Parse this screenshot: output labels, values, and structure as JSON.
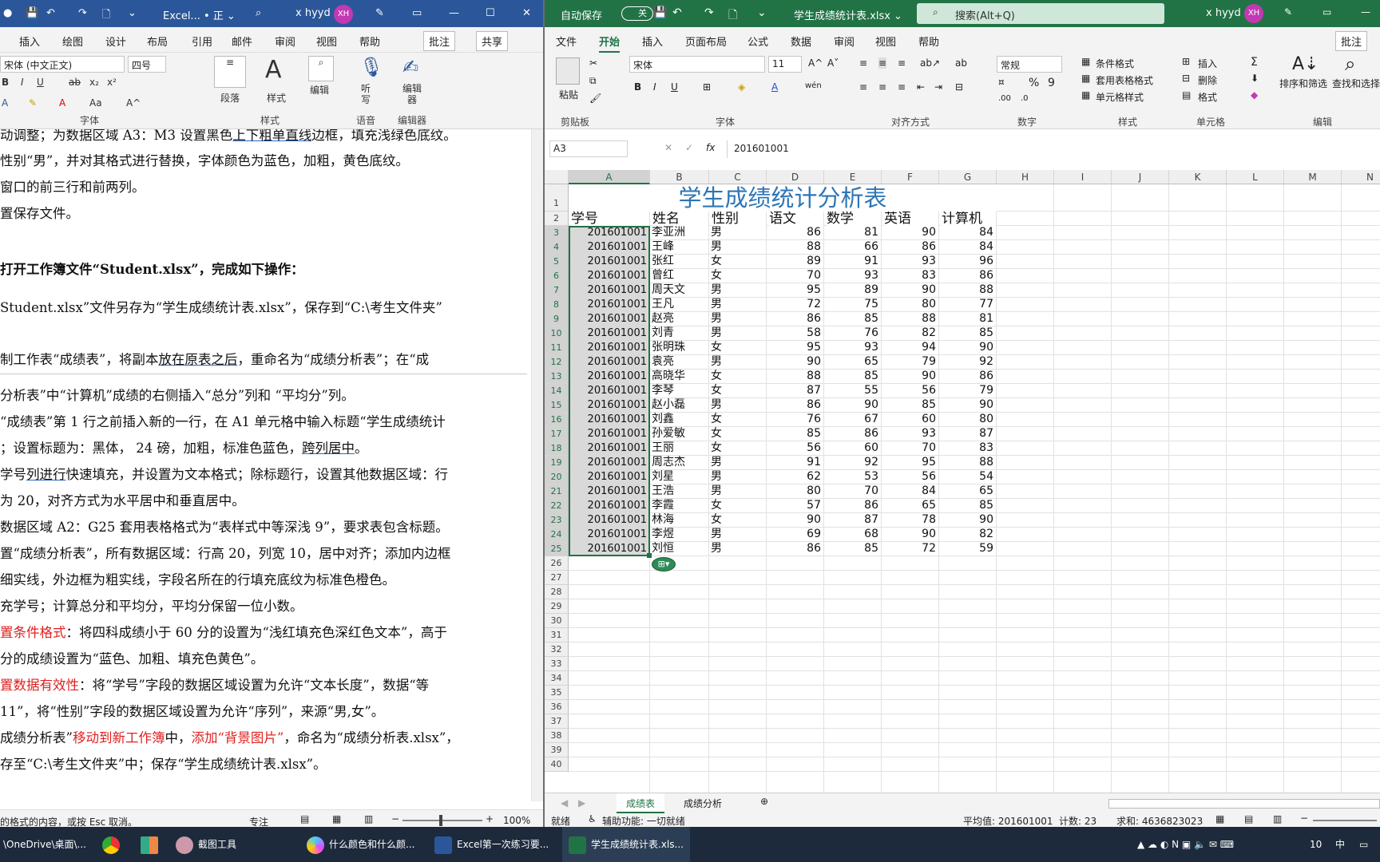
{
  "word": {
    "title": "Excel... • 正 ⌄",
    "search_icon": "search-icon",
    "user": "x hyyd",
    "avatar": "XH",
    "menu": [
      "插入",
      "绘图",
      "设计",
      "布局",
      "引用",
      "邮件",
      "审阅",
      "视图",
      "帮助"
    ],
    "comment_btn": "批注",
    "share_btn": "共享",
    "font_name": "宋体 (中文正文)",
    "font_size": "四号",
    "group_font": "字体",
    "btn_paragraph": "段落",
    "btn_style": "样式",
    "btn_edit": "编辑",
    "btn_dictate": "听写",
    "btn_editor": "编辑器",
    "group_style": "样式",
    "group_voice": "语音",
    "group_editor": "编辑器",
    "lines": [
      {
        "pre": "动调整；为数据区域 A3：M3 设置黑色",
        "ul": "上下粗单直线",
        "post": "边框，填充浅绿色底纹。"
      },
      {
        "text": "性别“男”，并对其格式进行替换，字体颜色为蓝色，加粗，黄色底纹。"
      },
      {
        "text": "窗口的前三行和前两列。"
      },
      {
        "text": "置保存文件。"
      },
      {
        "text": "打开工作簿文件“Student.xlsx”，完成如下操作："
      },
      {
        "text": "Student.xlsx”文件另存为“学生成绩统计表.xlsx”，保存到“C:\\考生文件夹”"
      },
      {
        "pre": "制工作表“成绩表”，将副本",
        "ul": "放在原表之后",
        "post": "，重命名为“成绩分析表”；在“成"
      },
      {
        "text": "分析表”中“计算机”成绩的右侧插入“总分”列和 “平均分”列。"
      },
      {
        "text": "“成绩表”第 1 行之前插入新的一行，在 A1 单元格中输入标题“学生成绩统计"
      },
      {
        "pre": "；设置标题为：黑体，  24 磅，加粗，标准色蓝色，",
        "ul": "跨列居中",
        "post": "。"
      },
      {
        "pre": "学号",
        "ul": "列进行",
        "post": "快速填充，并设置为文本格式；除标题行，设置其他数据区域：行"
      },
      {
        "text": "为 20，对齐方式为水平居中和垂直居中。"
      },
      {
        "text": "数据区域 A2：G25 套用表格格式为“表样式中等深浅 9”，要求表包含标题。"
      },
      {
        "text": "置“成绩分析表”，所有数据区域：行高 20，列宽 10，居中对齐；添加内边框"
      },
      {
        "text": "细实线，外边框为粗实线，字段名所在的行填充底纹为标准色橙色。"
      },
      {
        "text": "充学号；计算总分和平均分，平均分保留一位小数。"
      },
      {
        "red": "置条件格式",
        "post": "：将四科成绩小于 60 分的设置为“浅红填充色深红色文本”，高于"
      },
      {
        "text": "分的成绩设置为“蓝色、加粗、填充色黄色”。"
      },
      {
        "red": "置数据有效性",
        "post": "：将“学号”字段的数据区域设置为允许“文本长度”，数据“等"
      },
      {
        "text": "11”，将“性别”字段的数据区域设置为允许“序列”，来源“男,女”。"
      },
      {
        "pre": "成绩分析表”",
        "red": "移动到新工作簿",
        "mid": "中，",
        "red2": "添加“背景图片”",
        "post": "，命名为“成绩分析表.xlsx”，"
      },
      {
        "text": "存至“C:\\考生文件夹”中；保存“学生成绩统计表.xlsx”。"
      }
    ],
    "status_left": "的格式的内容，或按 Esc 取消。",
    "status_focus": "专注",
    "zoom": "100%"
  },
  "excel": {
    "autosave": "自动保存",
    "autosave_state": "关",
    "filename": "学生成绩统计表.xlsx ⌄",
    "search_placeholder": "搜索(Alt+Q)",
    "user": "x hyyd",
    "avatar": "XH",
    "menu": [
      "文件",
      "开始",
      "插入",
      "页面布局",
      "公式",
      "数据",
      "审阅",
      "视图",
      "帮助"
    ],
    "comment_btn": "批注",
    "paste": "粘贴",
    "font_name": "宋体",
    "font_size": "11",
    "number_format": "常规",
    "cond_format": "条件格式",
    "table_format": "套用表格格式",
    "cell_style": "单元格样式",
    "insert": "插入",
    "delete": "删除",
    "format": "格式",
    "sort_filter": "排序和筛选",
    "find_select": "查找和选择",
    "groups": [
      "剪贴板",
      "字体",
      "对齐方式",
      "数字",
      "样式",
      "单元格",
      "编辑"
    ],
    "name_box": "A3",
    "formula": "201601001",
    "col_letters": [
      "A",
      "B",
      "C",
      "D",
      "E",
      "F",
      "G",
      "H",
      "I",
      "J",
      "K",
      "L",
      "M",
      "N"
    ],
    "title_cell": "学生成绩统计分析表",
    "headers": [
      "学号",
      "姓名",
      "性别",
      "语文",
      "数学",
      "英语",
      "计算机"
    ],
    "rows": [
      [
        "201601001",
        "李亚洲",
        "男",
        "86",
        "81",
        "90",
        "84"
      ],
      [
        "201601001",
        "王峰",
        "男",
        "88",
        "66",
        "86",
        "84"
      ],
      [
        "201601001",
        "张红",
        "女",
        "89",
        "91",
        "93",
        "96"
      ],
      [
        "201601001",
        "曾红",
        "女",
        "70",
        "93",
        "83",
        "86"
      ],
      [
        "201601001",
        "周天文",
        "男",
        "95",
        "89",
        "90",
        "88"
      ],
      [
        "201601001",
        "王凡",
        "男",
        "72",
        "75",
        "80",
        "77"
      ],
      [
        "201601001",
        "赵亮",
        "男",
        "86",
        "85",
        "88",
        "81"
      ],
      [
        "201601001",
        "刘青",
        "男",
        "58",
        "76",
        "82",
        "85"
      ],
      [
        "201601001",
        "张明珠",
        "女",
        "95",
        "93",
        "94",
        "90"
      ],
      [
        "201601001",
        "袁亮",
        "男",
        "90",
        "65",
        "79",
        "92"
      ],
      [
        "201601001",
        "高晓华",
        "女",
        "88",
        "85",
        "90",
        "86"
      ],
      [
        "201601001",
        "李琴",
        "女",
        "87",
        "55",
        "56",
        "79"
      ],
      [
        "201601001",
        "赵小磊",
        "男",
        "86",
        "90",
        "85",
        "90"
      ],
      [
        "201601001",
        "刘鑫",
        "女",
        "76",
        "67",
        "60",
        "80"
      ],
      [
        "201601001",
        "孙爱敏",
        "女",
        "85",
        "86",
        "93",
        "87"
      ],
      [
        "201601001",
        "王丽",
        "女",
        "56",
        "60",
        "70",
        "83"
      ],
      [
        "201601001",
        "周志杰",
        "男",
        "91",
        "92",
        "95",
        "88"
      ],
      [
        "201601001",
        "刘星",
        "男",
        "62",
        "53",
        "56",
        "54"
      ],
      [
        "201601001",
        "王浩",
        "男",
        "80",
        "70",
        "84",
        "65"
      ],
      [
        "201601001",
        "李霞",
        "女",
        "57",
        "86",
        "65",
        "85"
      ],
      [
        "201601001",
        "林海",
        "女",
        "90",
        "87",
        "78",
        "90"
      ],
      [
        "201601001",
        "李煜",
        "男",
        "69",
        "68",
        "90",
        "82"
      ],
      [
        "201601001",
        "刘恒",
        "男",
        "86",
        "85",
        "72",
        "59"
      ]
    ],
    "row_numbers": [
      "1",
      "2",
      "3",
      "4",
      "5",
      "6",
      "7",
      "8",
      "9",
      "10",
      "11",
      "12",
      "13",
      "14",
      "15",
      "16",
      "17",
      "18",
      "19",
      "20",
      "21",
      "22",
      "23",
      "24",
      "25",
      "26",
      "27",
      "28",
      "29",
      "30",
      "31",
      "32",
      "33",
      "34",
      "35",
      "36",
      "37",
      "38",
      "39",
      "40"
    ],
    "sheet_tabs": [
      "成绩表",
      "成绩分析"
    ],
    "status_ready": "就绪",
    "status_access": "辅助功能: 一切就绪",
    "status_avg": "平均值: 201601001",
    "status_count": "计数: 23",
    "status_sum": "求和: 4636823023",
    "accent": "#217346",
    "title_color": "#2e75b6"
  },
  "taskbar": {
    "items": [
      "\\OneDrive\\桌面\\...",
      "截图工具",
      "什么颜色和什么颜...",
      "Excel第一次练习要...",
      "学生成绩统计表.xls..."
    ],
    "tray_time": "10",
    "ime": "中"
  }
}
